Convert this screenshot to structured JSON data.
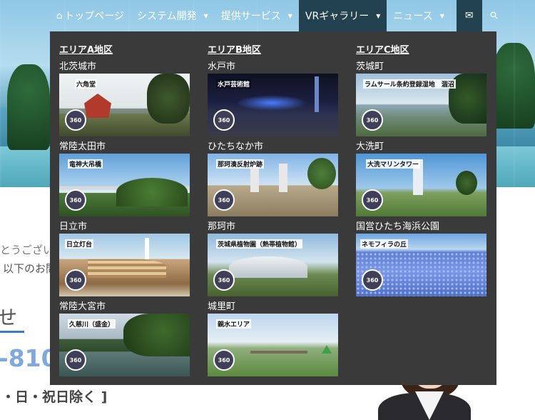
{
  "nav": {
    "items": [
      {
        "label": "トップページ",
        "icon": "home-icon",
        "has_caret": false
      },
      {
        "label": "システム開発",
        "has_caret": true
      },
      {
        "label": "提供サービス",
        "has_caret": true
      },
      {
        "label": "VRギャラリー",
        "has_caret": true,
        "active": true
      },
      {
        "label": "ニュース",
        "has_caret": true
      }
    ],
    "caret_glyph": "▼",
    "home_glyph": "⌂",
    "mail_glyph": "✉",
    "search_glyph": "⚲"
  },
  "background": {
    "line1": "とうございま",
    "line2": "以下のお問",
    "heading": "せ",
    "phone": "-810",
    "hours": "・日・祝日除く ]"
  },
  "mega_menu": {
    "badge_label": "360",
    "areas": [
      {
        "title": "エリアA地区",
        "entries": [
          {
            "city": "北茨城市",
            "caption": "六角堂"
          },
          {
            "city": "常陸太田市",
            "caption": "竜神大吊橋"
          },
          {
            "city": "日立市",
            "caption": "日立灯台"
          },
          {
            "city": "常陸大宮市",
            "caption": "久慈川（盛金）"
          }
        ]
      },
      {
        "title": "エリアB地区",
        "entries": [
          {
            "city": "水戸市",
            "caption": "水戸芸術館"
          },
          {
            "city": "ひたちなか市",
            "caption": "那珂湊反射炉跡"
          },
          {
            "city": "那珂市",
            "caption": "茨城県植物園（熱帯植物館）"
          },
          {
            "city": "城里町",
            "caption": "親水エリア"
          }
        ]
      },
      {
        "title": "エリアC地区",
        "entries": [
          {
            "city": "茨城町",
            "caption": "ラムサール条約登録湿地　涸沼"
          },
          {
            "city": "大洗町",
            "caption": "大洗マリンタワー"
          },
          {
            "city": "国営ひたち海浜公園",
            "caption": "ネモフィラの丘"
          }
        ]
      }
    ]
  }
}
